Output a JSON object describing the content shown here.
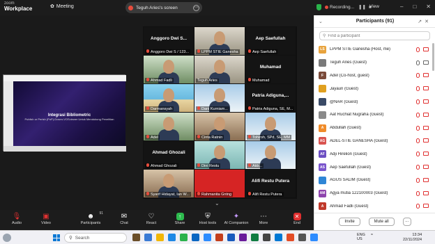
{
  "titlebar": {
    "brand_line1": "zoom",
    "brand_line2": "Workplace",
    "meeting_label": "Meeting",
    "screen_share_label": "Teguh Aries's screen",
    "recording_label": "Recording...",
    "view_label": "View"
  },
  "shared_screen": {
    "title": "Integrasi Bibliometric",
    "subtitle": "Publish or Perish (PoP)-Dosen-VOSviewer Untuk Mendukung Penelitian"
  },
  "gallery": {
    "tiles": [
      {
        "caption": "Anggoro Dwi S / 123...",
        "big": "Anggoro Dwi S...",
        "style": "none",
        "muted": true
      },
      {
        "caption": "LPPM STIE Ganesha",
        "big": "",
        "style": "v-office",
        "muted": true
      },
      {
        "caption": "Aep Saefullah",
        "big": "Aep Saefullah",
        "style": "none",
        "muted": true
      },
      {
        "caption": "Ahmad Fadli",
        "big": "",
        "style": "v-green",
        "muted": true
      },
      {
        "caption": "Teguh Aries",
        "big": "",
        "style": "v-office",
        "muted": false
      },
      {
        "caption": "Muhamad",
        "big": "Muhamad",
        "style": "none",
        "muted": true
      },
      {
        "caption": "Darmansyah",
        "big": "",
        "style": "v-beach",
        "muted": true
      },
      {
        "caption": "Dani Kurniam...",
        "big": "",
        "style": "v-blue",
        "muted": true
      },
      {
        "caption": "Patria Adiguna, SE, M...",
        "big": "Patria Adiguna,...",
        "style": "none",
        "muted": true
      },
      {
        "caption": "Adel",
        "big": "",
        "style": "v-green",
        "muted": true
      },
      {
        "caption": "Cinta Ratnin",
        "big": "",
        "style": "v-warm",
        "muted": true
      },
      {
        "caption": "Tohiroh, SPd, SE, MM",
        "big": "",
        "style": "v-blue",
        "muted": true
      },
      {
        "caption": "Ahmad Ghozali",
        "big": "Ahmad Ghozali",
        "style": "none",
        "muted": true
      },
      {
        "caption": "Dini Restu",
        "big": "",
        "style": "v-teal",
        "muted": true
      },
      {
        "caption": "Akb...",
        "big": "",
        "style": "v-blue",
        "muted": true
      },
      {
        "caption": "Syarif Hidayat, Ian W...",
        "big": "",
        "style": "v-warm",
        "muted": true
      },
      {
        "caption": "Rahmanita Gntng",
        "big": "",
        "style": "v-red",
        "muted": true
      },
      {
        "caption": "Alifi Restu Putera",
        "big": "Alifi Restu Putera",
        "style": "none",
        "muted": true
      }
    ]
  },
  "toolbar": {
    "audio": "Audio",
    "video": "Video",
    "participants": "Participants",
    "participants_count": "91",
    "chat": "Chat",
    "react": "React",
    "share": "Share",
    "host_tools": "Host tools",
    "ai_companion": "AI Companion",
    "more": "More",
    "end": "End"
  },
  "panel": {
    "title": "Participants (91)",
    "search_placeholder": "Find a participant",
    "participants": [
      {
        "initials": "LS",
        "color": "#e8a33d",
        "name": "LPPM STIE Ganesha (Host, me)",
        "mic": "muted",
        "cam": "off"
      },
      {
        "initials": "",
        "color": "#7a7a7a",
        "name": "Teguh Aries (Guest)",
        "mic": "on",
        "cam": "on"
      },
      {
        "initials": "F",
        "color": "#7b4b3a",
        "name": "Adel (Co-host, guest)",
        "mic": "muted",
        "cam": "off"
      },
      {
        "initials": "",
        "color": "#e0a020",
        "name": "Jayaun (Guest)",
        "mic": "muted",
        "cam": "off"
      },
      {
        "initials": "",
        "color": "#3a4a66",
        "name": "@NAR (Guest)",
        "mic": "muted",
        "cam": "off"
      },
      {
        "initials": "",
        "color": "#8a8a8a",
        "name": "Aat Ruchiat Nugraha (Guest)",
        "mic": "muted",
        "cam": "off"
      },
      {
        "initials": "A",
        "color": "#f08c2a",
        "name": "Abdullah (Guest)",
        "mic": "muted",
        "cam": "off"
      },
      {
        "initials": "AG",
        "color": "#d9534f",
        "name": "ADEL-STIE GANESHA (Guest)",
        "mic": "muted",
        "cam": "off"
      },
      {
        "initials": "AF",
        "color": "#6c4fc2",
        "name": "Adji Hirelion (Guest)",
        "mic": "muted",
        "cam": "off"
      },
      {
        "initials": "AS",
        "color": "#7a55cc",
        "name": "Aep Saefullah (Guest)",
        "mic": "muted",
        "cam": "off"
      },
      {
        "initials": "",
        "color": "#2f86d6",
        "name": "AGUS SALIM (Guest)",
        "mic": "muted",
        "cam": "off"
      },
      {
        "initials": "AM",
        "color": "#8e44ad",
        "name": "Agya mutia 122100003 (Guest)",
        "mic": "muted",
        "cam": "off"
      },
      {
        "initials": "A",
        "color": "#c0392b",
        "name": "Ahmad Fadli (Guest)",
        "mic": "muted",
        "cam": "off"
      }
    ],
    "invite_label": "Invite",
    "mute_all_label": "Mute all",
    "more_label": "..."
  },
  "taskbar": {
    "search_label": "Search",
    "lang_line1": "ENG",
    "lang_line2": "US",
    "time": "13:34",
    "date": "22/11/2024"
  }
}
